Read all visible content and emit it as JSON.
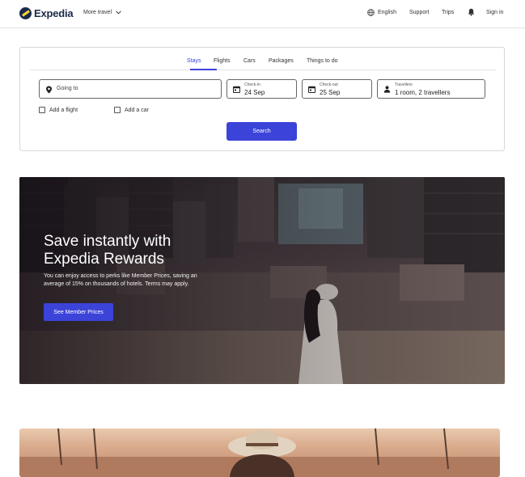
{
  "header": {
    "logo_text": "Expedia",
    "more_travel": "More travel",
    "language": "English",
    "support": "Support",
    "trips": "Trips",
    "sign_in": "Sign in"
  },
  "search": {
    "tabs": [
      "Stays",
      "Flights",
      "Cars",
      "Packages",
      "Things to do"
    ],
    "active_tab": "Stays",
    "going_to_placeholder": "Going to",
    "checkin_label": "Check-in",
    "checkin_value": "24 Sep",
    "checkout_label": "Check-out",
    "checkout_value": "25 Sep",
    "travellers_label": "Travellers",
    "travellers_value": "1 room, 2 travellers",
    "add_flight": "Add a flight",
    "add_car": "Add a car",
    "search_button": "Search"
  },
  "hero": {
    "title": "Save instantly with Expedia Rewards",
    "subtitle": "You can enjoy access to perks like Member Prices, saving an average of 15% on thousands of hotels. Terms may apply.",
    "cta": "See Member Prices"
  },
  "colors": {
    "accent": "#3b43d9",
    "brand_navy": "#1b2a4a",
    "brand_yellow": "#fdd835"
  }
}
